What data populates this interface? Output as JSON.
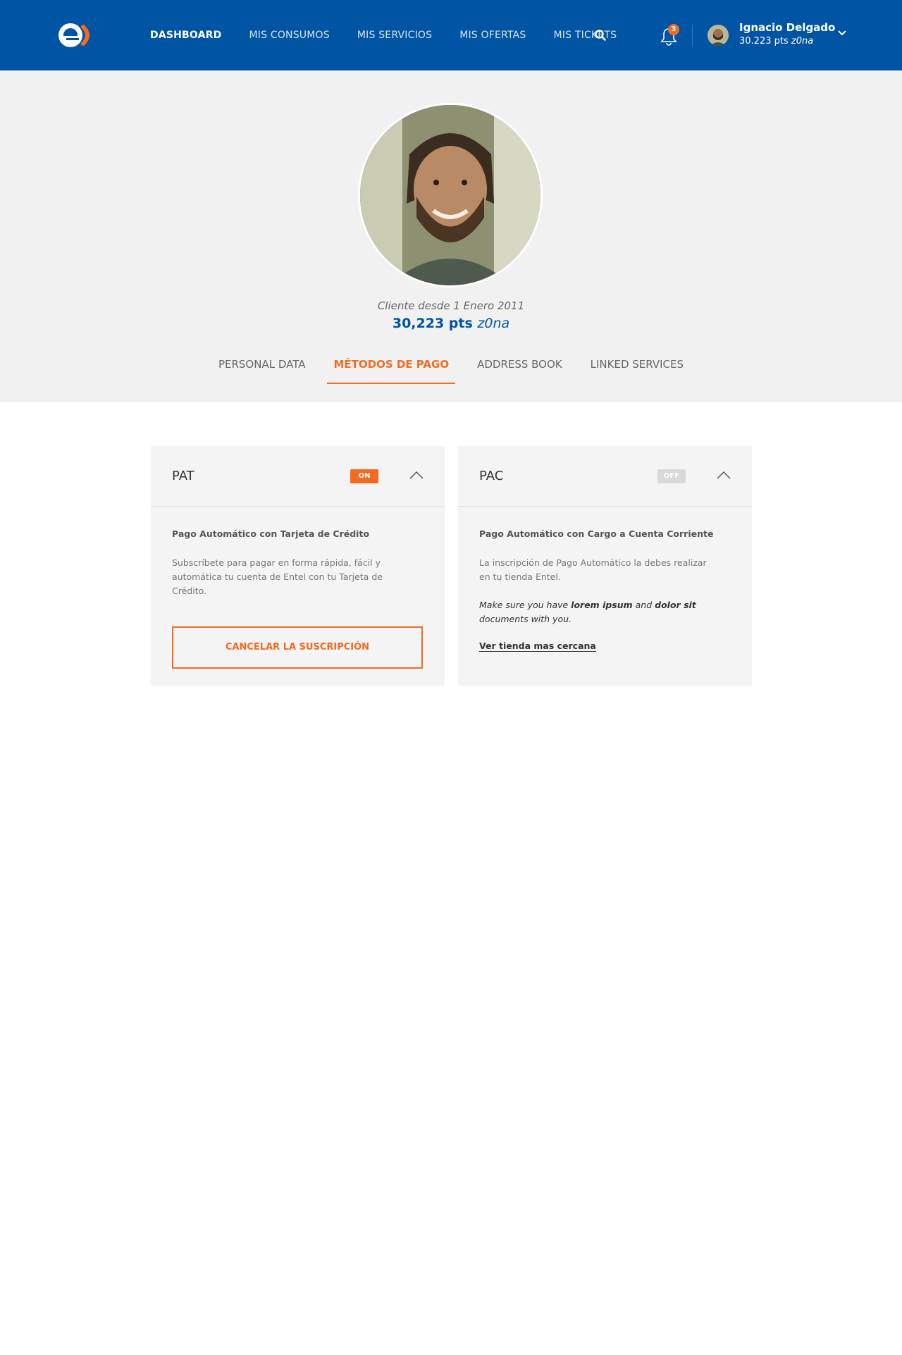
{
  "header": {
    "nav": [
      "DASHBOARD",
      "MIS CONSUMOS",
      "MIS SERVICIOS",
      "MIS OFERTAS",
      "MIS TICKETS"
    ],
    "notifications_count": "3",
    "user_name": "Ignacio Delgado",
    "user_points": "30.223 pts",
    "user_points_brand": "z0na"
  },
  "profile": {
    "since": "Cliente desde 1 Enero 2011",
    "points": "30,223 pts",
    "points_brand": "z0na"
  },
  "tabs": [
    "PERSONAL DATA",
    "MÉTODOS DE PAGO",
    "ADDRESS BOOK",
    "LINKED SERVICES"
  ],
  "cards": {
    "pat": {
      "title": "PAT",
      "status": "ON",
      "subtitle": "Pago Automático con Tarjeta de Crédito",
      "description": "Subscríbete para pagar en forma rápida, fácil y automática tu cuenta de Entel con tu Tarjeta de Crédito.",
      "button": "CANCELAR LA SUSCRIPCIÓN"
    },
    "pac": {
      "title": "PAC",
      "status": "OFF",
      "subtitle": "Pago Automático con Cargo a Cuenta Corriente",
      "description": "La inscripción de Pago Automático la debes realizar en tu tienda Entel.",
      "note_pre": "Make sure you have ",
      "note_b1": "lorem ipsum",
      "note_mid": " and ",
      "note_b2": "dolor sit",
      "note_post": " documents with you.",
      "link": "Ver tienda mas cercana"
    }
  },
  "colors": {
    "brand_blue": "#0054a4",
    "accent_orange": "#f26b21",
    "band_gray": "#f1f1f1"
  },
  "icons": [
    "entel-logo",
    "search-icon",
    "bell-icon",
    "chevron-down-icon",
    "chevron-up-icon"
  ]
}
